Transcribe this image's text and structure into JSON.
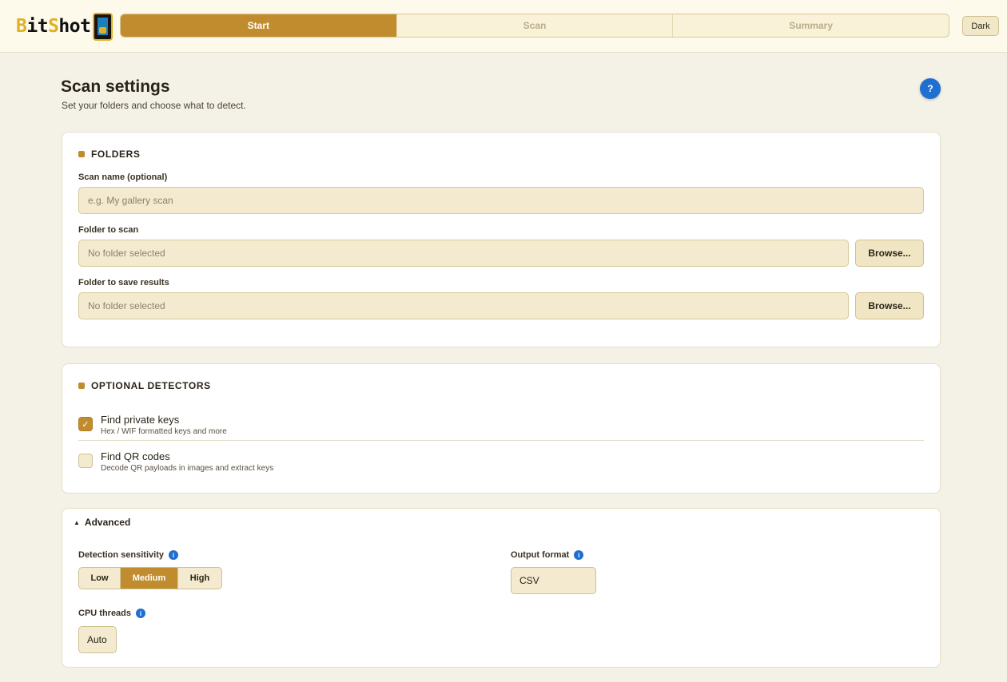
{
  "header": {
    "logo_prefix": "B",
    "logo_mid": "it",
    "logo_s": "S",
    "logo_suffix": "hot",
    "steps": [
      {
        "label": "Start",
        "active": true
      },
      {
        "label": "Scan",
        "active": false
      },
      {
        "label": "Summary",
        "active": false
      }
    ],
    "theme_toggle": "Dark"
  },
  "page": {
    "title": "Scan settings",
    "subtitle": "Set your folders and choose what to detect.",
    "help_label": "?"
  },
  "folders": {
    "title": "FOLDERS",
    "scan_name_label": "Scan name (optional)",
    "scan_name_placeholder": "e.g. My gallery scan",
    "scan_folder_label": "Folder to scan",
    "scan_folder_value": "No folder selected",
    "results_folder_label": "Folder to save results",
    "results_folder_value": "No folder selected",
    "browse_label": "Browse..."
  },
  "detectors": {
    "title": "OPTIONAL DETECTORS",
    "items": [
      {
        "label": "Find private keys",
        "description": "Hex / WIF formatted keys and more",
        "checked": true
      },
      {
        "label": "Find QR codes",
        "description": "Decode QR payloads in images and extract keys",
        "checked": false
      }
    ],
    "check_mark": "✓"
  },
  "advanced": {
    "toggle_label": "Advanced",
    "toggle_arrow": "▲",
    "sensitivity_label": "Detection sensitivity",
    "sensitivity_options": [
      "Low",
      "Medium",
      "High"
    ],
    "sensitivity_selected": "Medium",
    "output_format_label": "Output format",
    "output_format_value": "CSV",
    "cpu_threads_label": "CPU threads",
    "cpu_threads_value": "Auto",
    "info_glyph": "i"
  },
  "colors": {
    "accent": "#c08c2e",
    "info_blue": "#1f6fd0",
    "background": "#f4f1e6"
  }
}
